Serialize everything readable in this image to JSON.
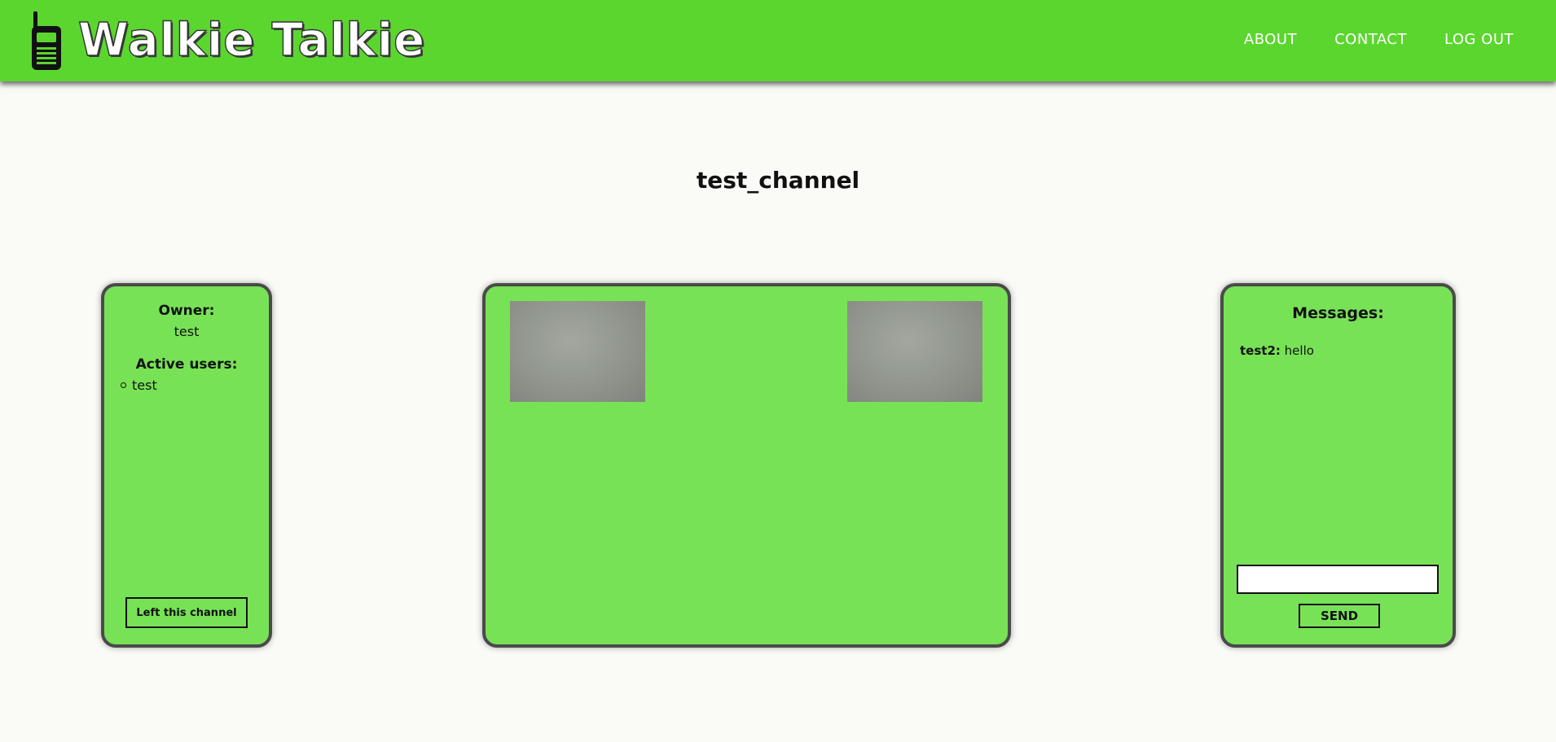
{
  "app": {
    "title": "Walkie Talkie",
    "brand_color": "#5bd62f",
    "panel_color": "#78e257"
  },
  "nav": {
    "items": [
      {
        "label": "ABOUT"
      },
      {
        "label": "CONTACT"
      },
      {
        "label": "LOG OUT"
      }
    ]
  },
  "channel": {
    "title": "test_channel"
  },
  "info_panel": {
    "owner_label": "Owner:",
    "owner_name": "test",
    "active_users_label": "Active users:",
    "active_users": [
      "test"
    ],
    "leave_label": "Left this channel"
  },
  "video_panel": {
    "streams": [
      "video-stream",
      "video-stream"
    ]
  },
  "messages_panel": {
    "label": "Messages:",
    "messages": [
      {
        "user": "test2:",
        "text": "hello"
      }
    ],
    "input_value": "",
    "input_placeholder": "",
    "send_label": "SEND"
  }
}
